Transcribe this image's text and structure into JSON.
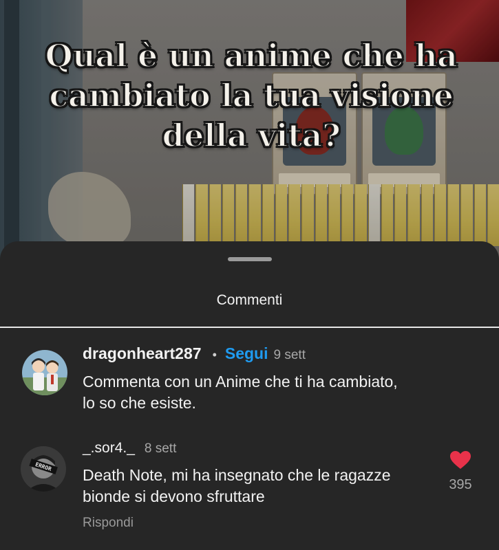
{
  "video": {
    "overlay_question": "Qual è un anime che ha cambiato la tua visione della vita?"
  },
  "comments_sheet": {
    "title": "Commenti",
    "comments": [
      {
        "username": "dragonheart287",
        "follow_label": "Segui",
        "time": "9 sett",
        "text": "Commenta con un Anime che ti ha cambiato,\nlo so che esiste."
      },
      {
        "username": "_.sor4._",
        "time": "8 sett",
        "text": "Death Note, mi ha insegnato che le ragazze\nbionde si devono sfruttare",
        "reply_label": "Rispondi",
        "likes": "395",
        "avatar_badge": "ERROR"
      }
    ]
  },
  "colors": {
    "sheet_background": "#262626",
    "follow_blue": "#1f9bf0",
    "like_red": "#e8324a"
  }
}
